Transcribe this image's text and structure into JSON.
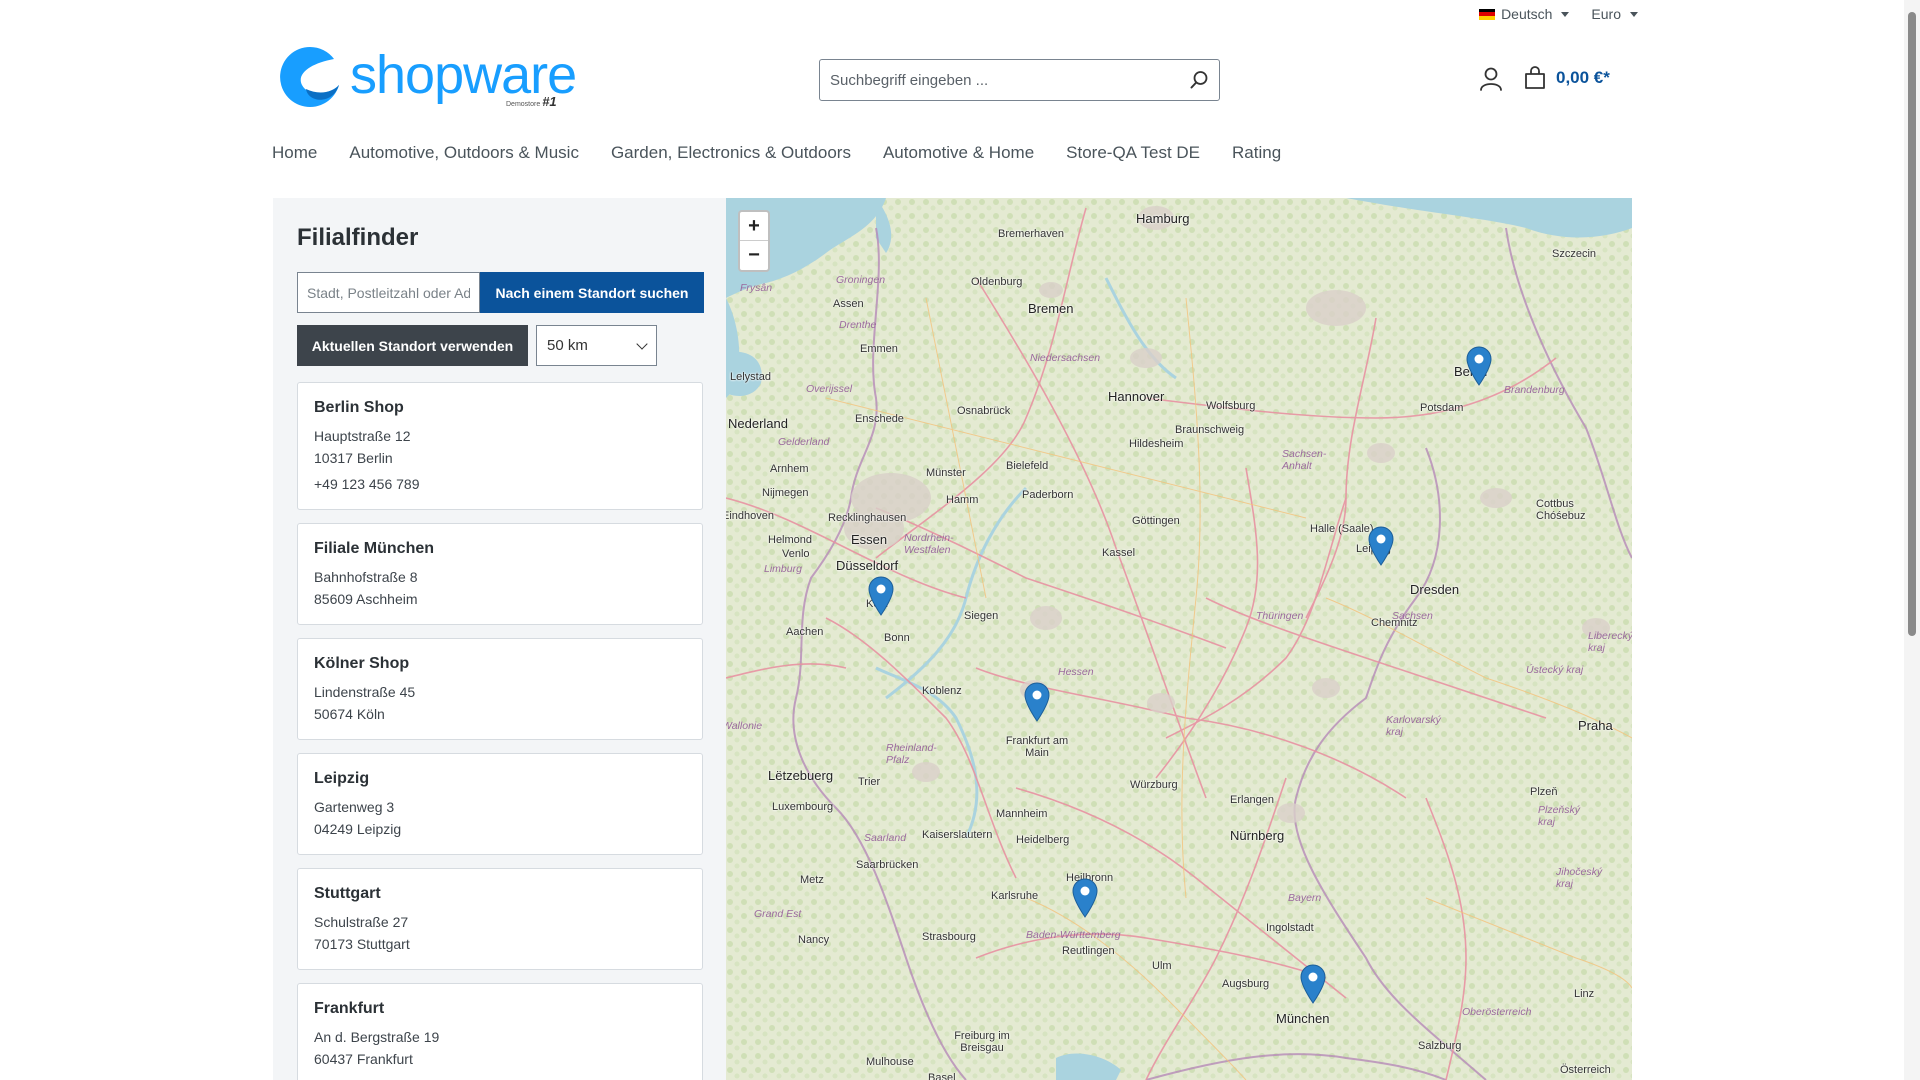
{
  "topbar": {
    "language": "Deutsch",
    "currency": "Euro"
  },
  "header": {
    "logo_text": "shopware",
    "logo_sub": "Demostore",
    "logo_tag": "#1",
    "search_placeholder": "Suchbegriff eingeben ...",
    "cart_value": "0,00 €*"
  },
  "nav": {
    "items": [
      {
        "label": "Home"
      },
      {
        "label": "Automotive, Outdoors & Music"
      },
      {
        "label": "Garden, Electronics & Outdoors"
      },
      {
        "label": "Automotive & Home"
      },
      {
        "label": "Store-QA Test DE"
      },
      {
        "label": "Rating"
      }
    ]
  },
  "finder": {
    "title": "Filialfinder",
    "location_placeholder": "Stadt, Postleitzahl oder Adresse",
    "search_button": "Nach einem Standort suchen",
    "current_location_button": "Aktuellen Standort verwenden",
    "radius": "50 km"
  },
  "stores": [
    {
      "name": "Berlin Shop",
      "street": "Hauptstraße 12",
      "city": "10317 Berlin",
      "phone": "+49 123 456 789"
    },
    {
      "name": "Filiale München",
      "street": "Bahnhofstraße 8",
      "city": "85609 Aschheim",
      "phone": ""
    },
    {
      "name": "Kölner Shop",
      "street": "Lindenstraße 45",
      "city": "50674 Köln",
      "phone": ""
    },
    {
      "name": "Leipzig",
      "street": "Gartenweg 3",
      "city": "04249 Leipzig",
      "phone": ""
    },
    {
      "name": "Stuttgart",
      "street": "Schulstraße 27",
      "city": "70173 Stuttgart",
      "phone": ""
    },
    {
      "name": "Frankfurt",
      "street": "An d. Bergstraße 19",
      "city": "60437 Frankfurt",
      "phone": ""
    }
  ],
  "map": {
    "zoom_in": "+",
    "zoom_out": "−",
    "cities": [
      "Hamburg",
      "Bremerhaven",
      "Oldenburg",
      "Bremen",
      "Groningen",
      "Assen",
      "Drenthe",
      "Emmen",
      "Lelystad",
      "Overijssel",
      "Nederland",
      "Enschede",
      "Osnabrück",
      "Hannover",
      "Wolfsburg",
      "Braunschweig",
      "Hildesheim",
      "Gelderland",
      "Arnhem",
      "Nijmegen",
      "Münster",
      "Bielefeld",
      "Hamm",
      "Paderborn",
      "Recklinghausen",
      "Essen",
      "Düsseldorf",
      "Göttingen",
      "Kassel",
      "Halle (Saale)",
      "Leipzig",
      "Dresden",
      "Chemnitz",
      "Köln",
      "Bonn",
      "Aachen",
      "Siegen",
      "Koblenz",
      "Frankfurt am Main",
      "Hessen",
      "Thüringen",
      "Sachsen",
      "Sachsen-Anhalt",
      "Niedersachsen",
      "Nordrhein-Westfalen",
      "Venlo",
      "Helmond",
      "Limburg",
      "Eindhoven",
      "Lëtzebuerg",
      "Luxembourg",
      "Trier",
      "Rheinland-Pfalz",
      "Mannheim",
      "Heidelberg",
      "Würzburg",
      "Erlangen",
      "Nürnberg",
      "Saarland",
      "Saarbrücken",
      "Kaiserslautern",
      "Metz",
      "Nancy",
      "Grand Est",
      "Strasbourg",
      "Karlsruhe",
      "Heilbronn",
      "Baden-Württemberg",
      "Reutlingen",
      "Ulm",
      "Augsburg",
      "Ingolstadt",
      "Bayern",
      "München",
      "Freiburg im Breisgau",
      "Mulhouse",
      "Basel",
      "Praha",
      "Plzeň",
      "Plzeňský kraj",
      "Karlovarský kraj",
      "Ústecký kraj",
      "Liberecký kraj",
      "Jihočeský kraj",
      "Oberösterreich",
      "Linz",
      "Salzburg",
      "Österreich",
      "Szczecin",
      "Berlin",
      "Potsdam",
      "Brandenburg",
      "Cottbus Chóśebuz",
      "Wallonie",
      "Frysân"
    ]
  }
}
